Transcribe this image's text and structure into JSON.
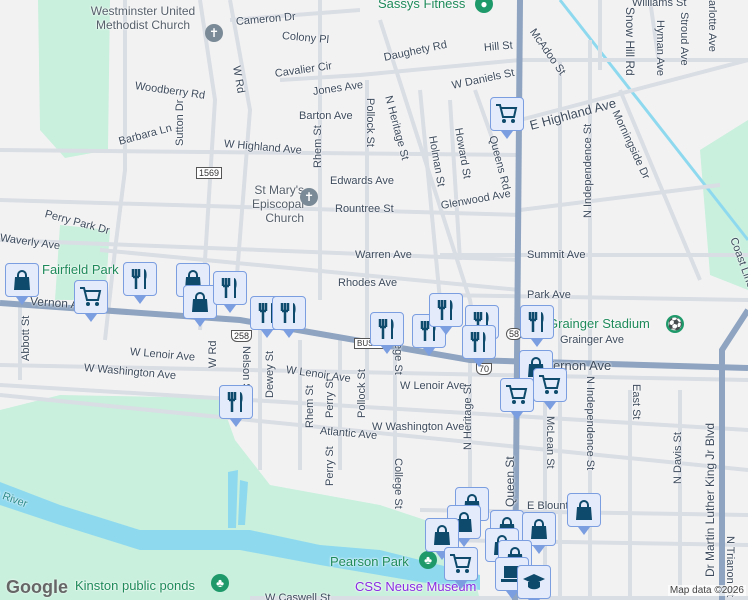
{
  "map": {
    "streets": [
      "Cameron Dr",
      "Colony Pl",
      "Cavalier Cir",
      "Jones Ave",
      "Barton Ave",
      "Woodberry Rd",
      "W Rd",
      "Sutton Dr",
      "Barbara Ln",
      "W Highland Ave",
      "Rhem St",
      "Pollock St",
      "Edwards Ave",
      "Rountree St",
      "Perry Park Dr",
      "Waverly Ave",
      "Warren Ave",
      "Rhodes Ave",
      "Daughety Rd",
      "Hill St",
      "W Daniels St",
      "N Heritage St",
      "Holman St",
      "Howard St",
      "Queens Rd",
      "McAdoo St",
      "E Highland Ave",
      "N Independence St",
      "Morningside Dr",
      "Williams St",
      "Snow Hill Rd",
      "Hyman Ave",
      "Stroud Ave",
      "Charlotte Ave",
      "Glenwood Ave",
      "Summit Ave",
      "Park Ave",
      "Coast Line St",
      "Grainger Ave",
      "Vernon Ave",
      "Vernon Ave",
      "W Lenoir Ave",
      "W Lenoir Ave",
      "W Lenoir Ave",
      "W Washington Ave",
      "W Washington Ave",
      "Abbott St",
      "W Rd",
      "Nelson St",
      "Dewey St",
      "Rhem St",
      "Perry St",
      "Perry St",
      "Pollock St",
      "Atlantic Ave",
      "College St",
      "College St",
      "N Heritage St",
      "Queen St",
      "McLean St",
      "N Independence St",
      "East St",
      "N Davis St",
      "Dr Martin Luther King Jr Blvd",
      "N Trianon St",
      "E Blount",
      "W Caswell St",
      "Neuse River"
    ],
    "pois": {
      "westminster": "Westminster United Methodist Church",
      "st_marys": "St Mary's Episcopal Church",
      "sassys": "Sassys Fitness",
      "fairfield": "Fairfield Park",
      "grainger": "Grainger Stadium",
      "pearson": "Pearson Park",
      "css_neuse": "CSS Neuse Museum",
      "ponds": "Kinston public ponds"
    },
    "shields": [
      "1569",
      "258",
      "BUS 70",
      "58",
      "70"
    ],
    "attribution": "Map data ©2026",
    "logo": "Google"
  }
}
